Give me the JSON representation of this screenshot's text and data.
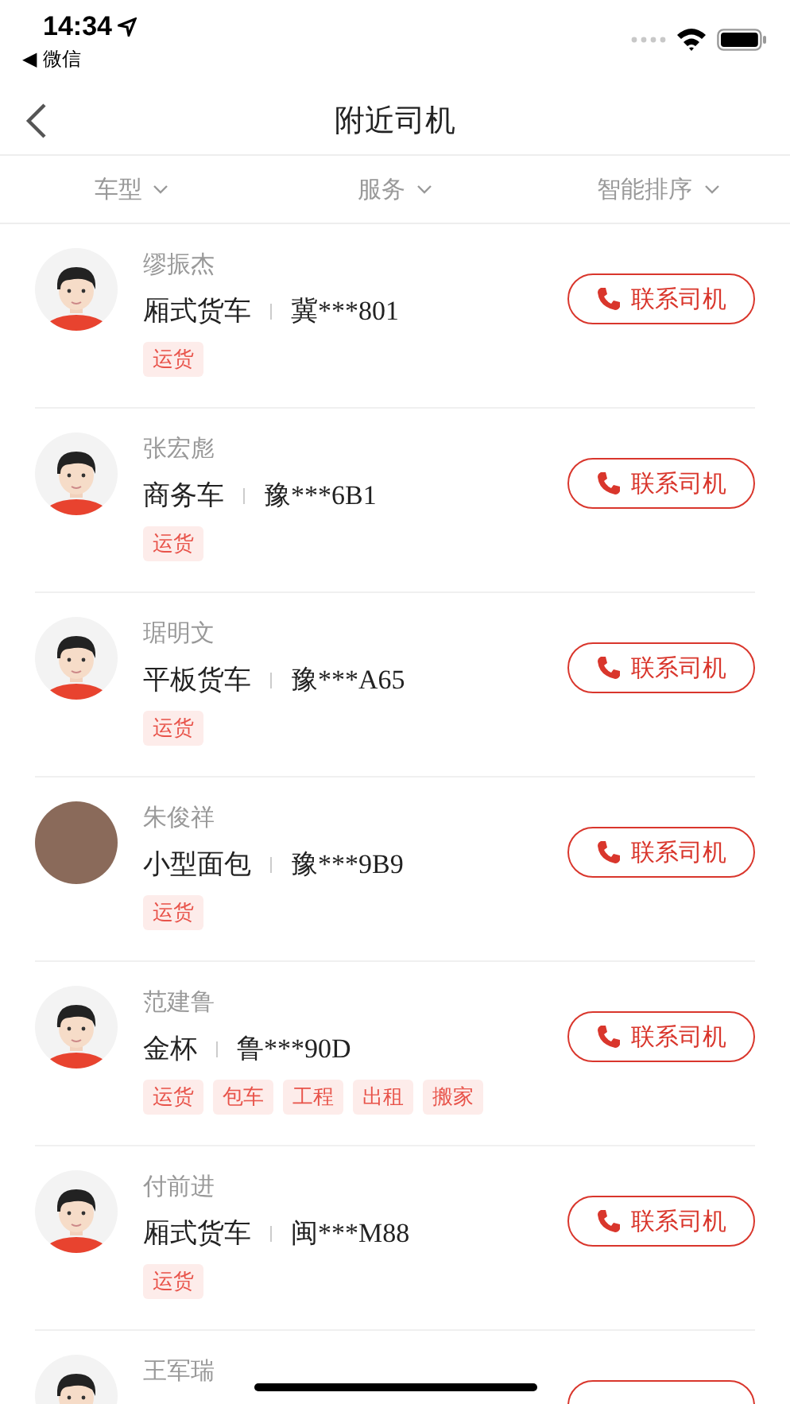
{
  "status_bar": {
    "time": "14:34",
    "back_app": "◀ 微信"
  },
  "nav": {
    "title": "附近司机"
  },
  "filters": [
    {
      "label": "车型"
    },
    {
      "label": "服务"
    },
    {
      "label": "智能排序"
    }
  ],
  "drivers": [
    {
      "name": "缪振杰",
      "vehicle": "厢式货车",
      "plate": "冀***801",
      "tags": [
        "运货"
      ],
      "kind": "cartoon",
      "button": "联系司机"
    },
    {
      "name": "张宏彪",
      "vehicle": "商务车",
      "plate": "豫***6B1",
      "tags": [
        "运货"
      ],
      "kind": "cartoon",
      "button": "联系司机"
    },
    {
      "name": "琚明文",
      "vehicle": "平板货车",
      "plate": "豫***A65",
      "tags": [
        "运货"
      ],
      "kind": "cartoon",
      "button": "联系司机"
    },
    {
      "name": "朱俊祥",
      "vehicle": "小型面包",
      "plate": "豫***9B9",
      "tags": [
        "运货"
      ],
      "kind": "photo",
      "button": "联系司机"
    },
    {
      "name": "范建鲁",
      "vehicle": "金杯",
      "plate": "鲁***90D",
      "tags": [
        "运货",
        "包车",
        "工程",
        "出租",
        "搬家"
      ],
      "kind": "cartoon",
      "button": "联系司机"
    },
    {
      "name": "付前进",
      "vehicle": "厢式货车",
      "plate": "闽***M88",
      "tags": [
        "运货"
      ],
      "kind": "cartoon",
      "button": "联系司机"
    },
    {
      "name": "王军瑞",
      "kind": "cartoon"
    }
  ]
}
